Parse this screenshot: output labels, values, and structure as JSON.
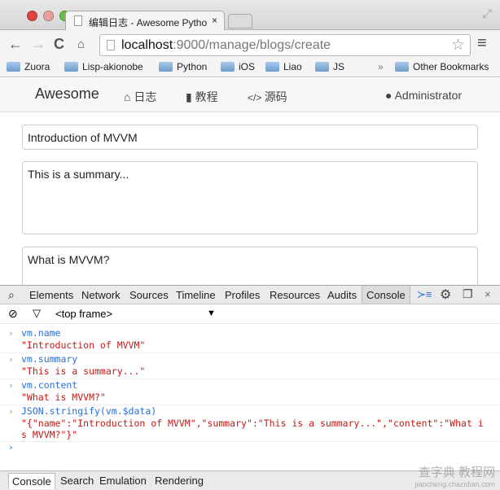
{
  "browser": {
    "tab_title": "编辑日志 - Awesome Pytho",
    "url_host": "localhost",
    "url_path": ":9000/manage/blogs/create",
    "bookmarks": [
      "Zuora",
      "Lisp-akionobe",
      "Python",
      "iOS",
      "Liao",
      "JS"
    ],
    "overflow": "»",
    "other_bookmarks": "Other Bookmarks",
    "traffic_colors": [
      "#e0443e",
      "#dea123",
      "#6bbd45"
    ]
  },
  "site": {
    "brand": "Awesome",
    "nav": [
      {
        "icon": "home-icon",
        "label": "日志"
      },
      {
        "icon": "book-icon",
        "label": "教程"
      },
      {
        "icon": "code-icon",
        "label": "源码"
      }
    ],
    "user": "Administrator"
  },
  "form": {
    "name": "Introduction of MVVM",
    "summary": "This is a summary...",
    "content": "What is MVVM?"
  },
  "devtools": {
    "tabs": [
      "Elements",
      "Network",
      "Sources",
      "Timeline",
      "Profiles",
      "Resources",
      "Audits",
      "Console"
    ],
    "active_tab": "Console",
    "frame": "<top frame>",
    "console": [
      {
        "input": "vm.name",
        "output": "\"Introduction of MVVM\""
      },
      {
        "input": "vm.summary",
        "output": "\"This is a summary...\""
      },
      {
        "input": "vm.content",
        "output": "\"What is MVVM?\""
      },
      {
        "input": "JSON.stringify(vm.$data)",
        "output": "\"{\"name\":\"Introduction of MVVM\",\"summary\":\"This is a summary...\",\"content\":\"What is MVVM?\"}\""
      }
    ],
    "drawer_tabs": [
      "Console",
      "Search",
      "Emulation",
      "Rendering"
    ]
  },
  "watermark": {
    "line1": "查字典 教程网",
    "line2": "jiaocheng.chazidian.com"
  }
}
